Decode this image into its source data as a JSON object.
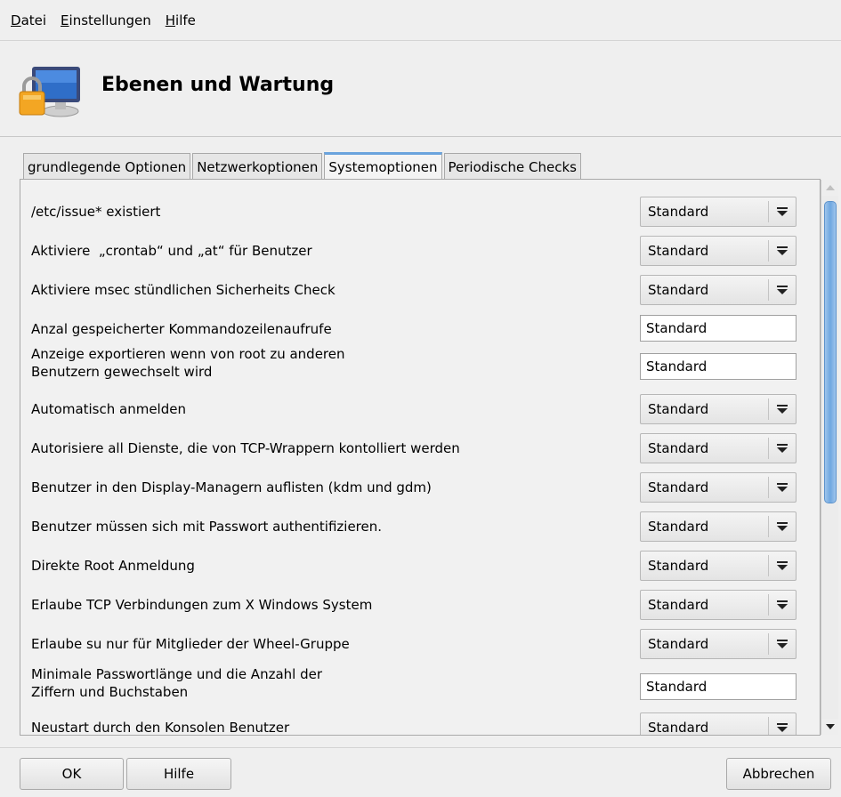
{
  "menu": [
    {
      "mnemonic": "D",
      "rest": "atei"
    },
    {
      "mnemonic": "E",
      "rest": "instellungen"
    },
    {
      "mnemonic": "H",
      "rest": "ilfe"
    }
  ],
  "header": {
    "title": "Ebenen und Wartung",
    "icon": "monitor-lock-icon"
  },
  "tabs": [
    {
      "label": "grundlegende Optionen",
      "active": false
    },
    {
      "label": "Netzwerkoptionen",
      "active": false
    },
    {
      "label": "Systemoptionen",
      "active": true
    },
    {
      "label": "Periodische Checks",
      "active": false
    }
  ],
  "options": [
    {
      "label": "/etc/issue* existiert",
      "control": "combo",
      "value": "Standard"
    },
    {
      "label": "Aktiviere  „crontab“ und „at“ für Benutzer",
      "control": "combo",
      "value": "Standard"
    },
    {
      "label": "Aktiviere msec stündlichen Sicherheits Check",
      "control": "combo",
      "value": "Standard"
    },
    {
      "label": "Anzal gespeicherter Kommandozeilenaufrufe",
      "control": "text",
      "value": "Standard"
    },
    {
      "label": "Anzeige exportieren wenn von root zu anderen\nBenutzern gewechselt wird",
      "control": "text",
      "value": "Standard"
    },
    {
      "label": "Automatisch anmelden",
      "control": "combo",
      "value": "Standard"
    },
    {
      "label": "Autorisiere all Dienste, die von TCP-Wrappern kontolliert werden",
      "control": "combo",
      "value": "Standard"
    },
    {
      "label": "Benutzer in den Display-Managern auflisten (kdm und gdm)",
      "control": "combo",
      "value": "Standard"
    },
    {
      "label": "Benutzer müssen sich mit Passwort authentifizieren.",
      "control": "combo",
      "value": "Standard"
    },
    {
      "label": "Direkte Root Anmeldung",
      "control": "combo",
      "value": "Standard"
    },
    {
      "label": "Erlaube TCP Verbindungen zum X Windows System",
      "control": "combo",
      "value": "Standard"
    },
    {
      "label": "Erlaube su nur für Mitglieder der Wheel-Gruppe",
      "control": "combo",
      "value": "Standard"
    },
    {
      "label": "Minimale Passwortlänge und die Anzahl der\nZiffern und Buchstaben",
      "control": "text",
      "value": "Standard"
    },
    {
      "label": "Neustart durch den Konsolen Benutzer",
      "control": "combo",
      "value": "Standard"
    }
  ],
  "footer": {
    "ok": "OK",
    "help": "Hilfe",
    "cancel": "Abbrechen"
  }
}
